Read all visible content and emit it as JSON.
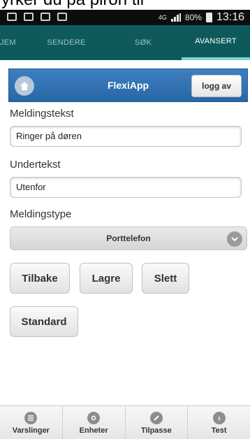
{
  "top_fragment": "yrker du på piron til",
  "status": {
    "network": "4G",
    "battery": "80%",
    "time": "13:16"
  },
  "tabs": [
    {
      "label": "JEM"
    },
    {
      "label": "SENDERE"
    },
    {
      "label": "SØK"
    },
    {
      "label": "AVANSERT"
    }
  ],
  "header": {
    "title": "FlexiApp",
    "logout_label": "logg av"
  },
  "form": {
    "message_label": "Meldingstekst",
    "message_value": "Ringer på døren",
    "subtext_label": "Undertekst",
    "subtext_value": "Utenfor",
    "type_label": "Meldingstype",
    "type_value": "Porttelefon"
  },
  "buttons": {
    "back": "Tilbake",
    "save": "Lagre",
    "delete": "Slett",
    "standard": "Standard"
  },
  "bottomnav": [
    {
      "label": "Varslinger",
      "icon": "list-icon"
    },
    {
      "label": "Enheter",
      "icon": "gear-icon"
    },
    {
      "label": "Tilpasse",
      "icon": "pencil-icon"
    },
    {
      "label": "Test",
      "icon": "info-icon"
    }
  ]
}
